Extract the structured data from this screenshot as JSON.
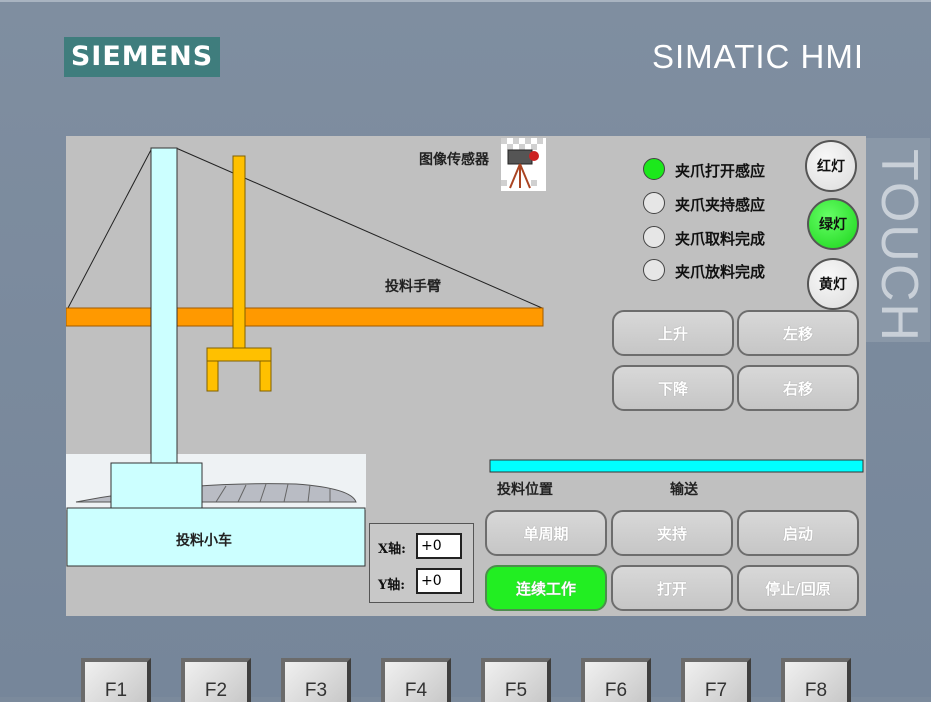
{
  "header": {
    "brand": "SIEMENS",
    "product": "SIMATIC HMI",
    "side_label": "TOUCH"
  },
  "scene": {
    "sensor_label": "图像传感器",
    "arm_label": "投料手臂",
    "cart_label": "投料小车",
    "feed_position_label": "投料位置",
    "conveyor_label": "输送"
  },
  "indicators": [
    {
      "label": "夹爪打开感应",
      "on": true
    },
    {
      "label": "夹爪夹持感应",
      "on": false
    },
    {
      "label": "夹爪取料完成",
      "on": false
    },
    {
      "label": "夹爪放料完成",
      "on": false
    }
  ],
  "lamps": [
    {
      "label": "红灯",
      "on": false
    },
    {
      "label": "绿灯",
      "on": true
    },
    {
      "label": "黄灯",
      "on": false
    }
  ],
  "jog_buttons": {
    "up": "上升",
    "left": "左移",
    "down": "下降",
    "right": "右移"
  },
  "axes": {
    "x_label": "X轴:",
    "x_value": "+0",
    "y_label": "Y轴:",
    "y_value": "+0"
  },
  "control_buttons": {
    "single_cycle": "单周期",
    "clamp": "夹持",
    "start": "启动",
    "continuous": "连续工作",
    "open": "打开",
    "stop_home": "停止/回原"
  },
  "colors": {
    "active_green": "#22ee22",
    "arm_orange": "#ff9900",
    "gripper_yellow": "#ffc000",
    "conveyor_cyan": "#00ffff",
    "column_cyan": "#ccffff"
  },
  "function_keys": [
    "F1",
    "F2",
    "F3",
    "F4",
    "F5",
    "F6",
    "F7",
    "F8"
  ]
}
